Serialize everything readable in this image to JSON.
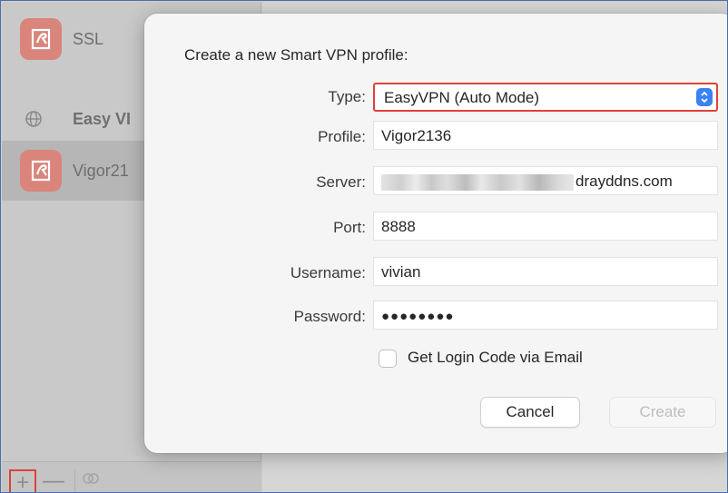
{
  "sidebar": {
    "items": [
      {
        "label": "SSL",
        "icon": "ssl-profile-icon"
      },
      {
        "label": "Easy VI",
        "icon": "globe-icon"
      },
      {
        "label": "Vigor21",
        "icon": "ssl-profile-icon"
      }
    ],
    "toolbar": {
      "add": "+",
      "remove": "—",
      "add_icon": "plus-icon",
      "remove_icon": "minus-icon",
      "connect_icon": "link-icon"
    }
  },
  "dialog": {
    "title": "Create a new Smart VPN profile:",
    "fields": {
      "type_label": "Type:",
      "type_value": "EasyVPN (Auto Mode)",
      "profile_label": "Profile:",
      "profile_value": "Vigor2136",
      "server_label": "Server:",
      "server_value": "drayddns.com",
      "port_label": "Port:",
      "port_value": "8888",
      "username_label": "Username:",
      "username_value": "vivian",
      "password_label": "Password:",
      "password_value": "●●●●●●●●"
    },
    "checkbox_label": "Get Login Code via Email",
    "cancel_label": "Cancel",
    "create_label": "Create"
  },
  "colors": {
    "highlight_border": "#e0403a",
    "accent": "#3a82f7",
    "profile_icon": "#d9857b"
  }
}
